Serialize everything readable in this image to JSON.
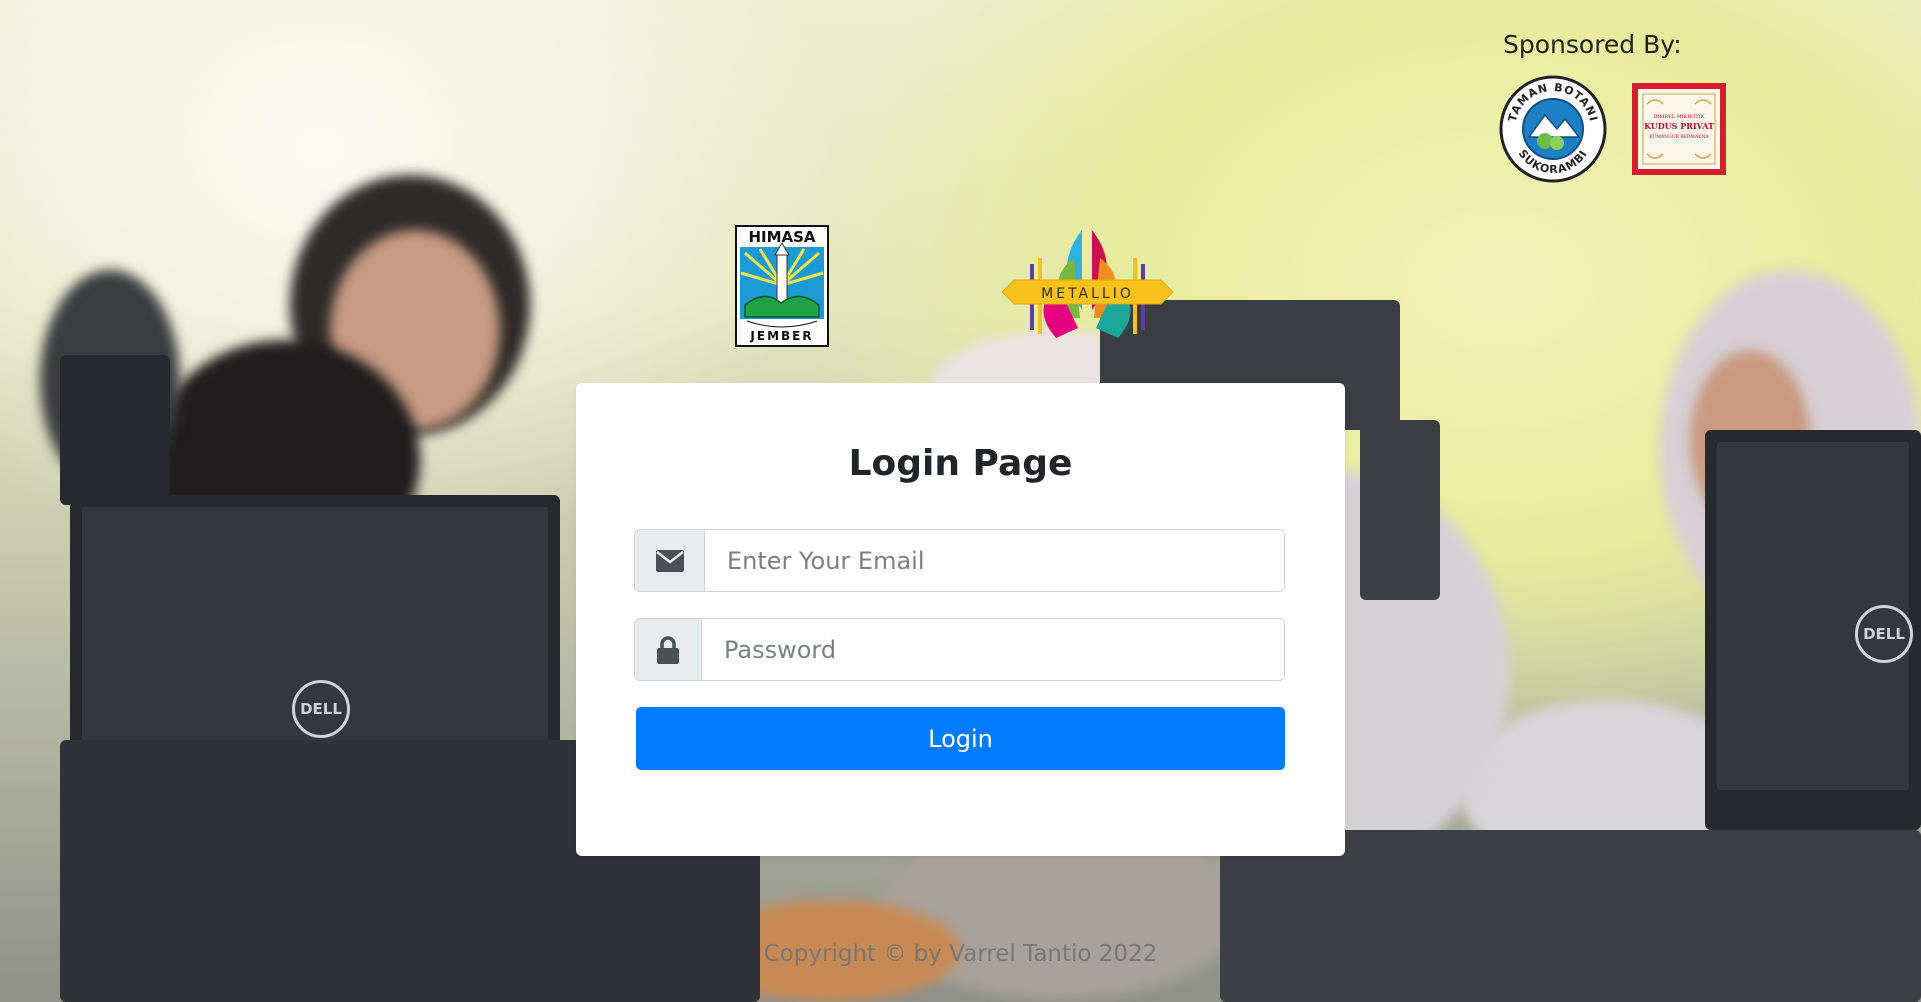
{
  "sponsors": {
    "title": "Sponsored By:",
    "items": [
      {
        "name": "Taman Botani Sukorambi",
        "top_text": "TAMAN BOTANI",
        "bottom_text": "SUKORAMBI"
      },
      {
        "name": "Kudus Privat",
        "lines": [
          "BIMBEL MIKROTIK",
          "KUDUS PRIVAT",
          "KUMANGUR BERMAKNA"
        ]
      }
    ]
  },
  "logos": {
    "himasa": {
      "top_text": "HIMASA",
      "bottom_text": "JEMBER"
    },
    "metallio": {
      "text": "METALLIO"
    }
  },
  "login": {
    "title": "Login Page",
    "email_placeholder": "Enter Your Email",
    "password_placeholder": "Password",
    "button_label": "Login"
  },
  "footer": {
    "copyright": "Copyright © by Varrel Tantio 2022"
  },
  "colors": {
    "primary": "#007bff",
    "addon_bg": "#e9ecef",
    "card_bg": "#ffffff"
  },
  "icons": {
    "email": "envelope-icon",
    "password": "lock-icon"
  }
}
